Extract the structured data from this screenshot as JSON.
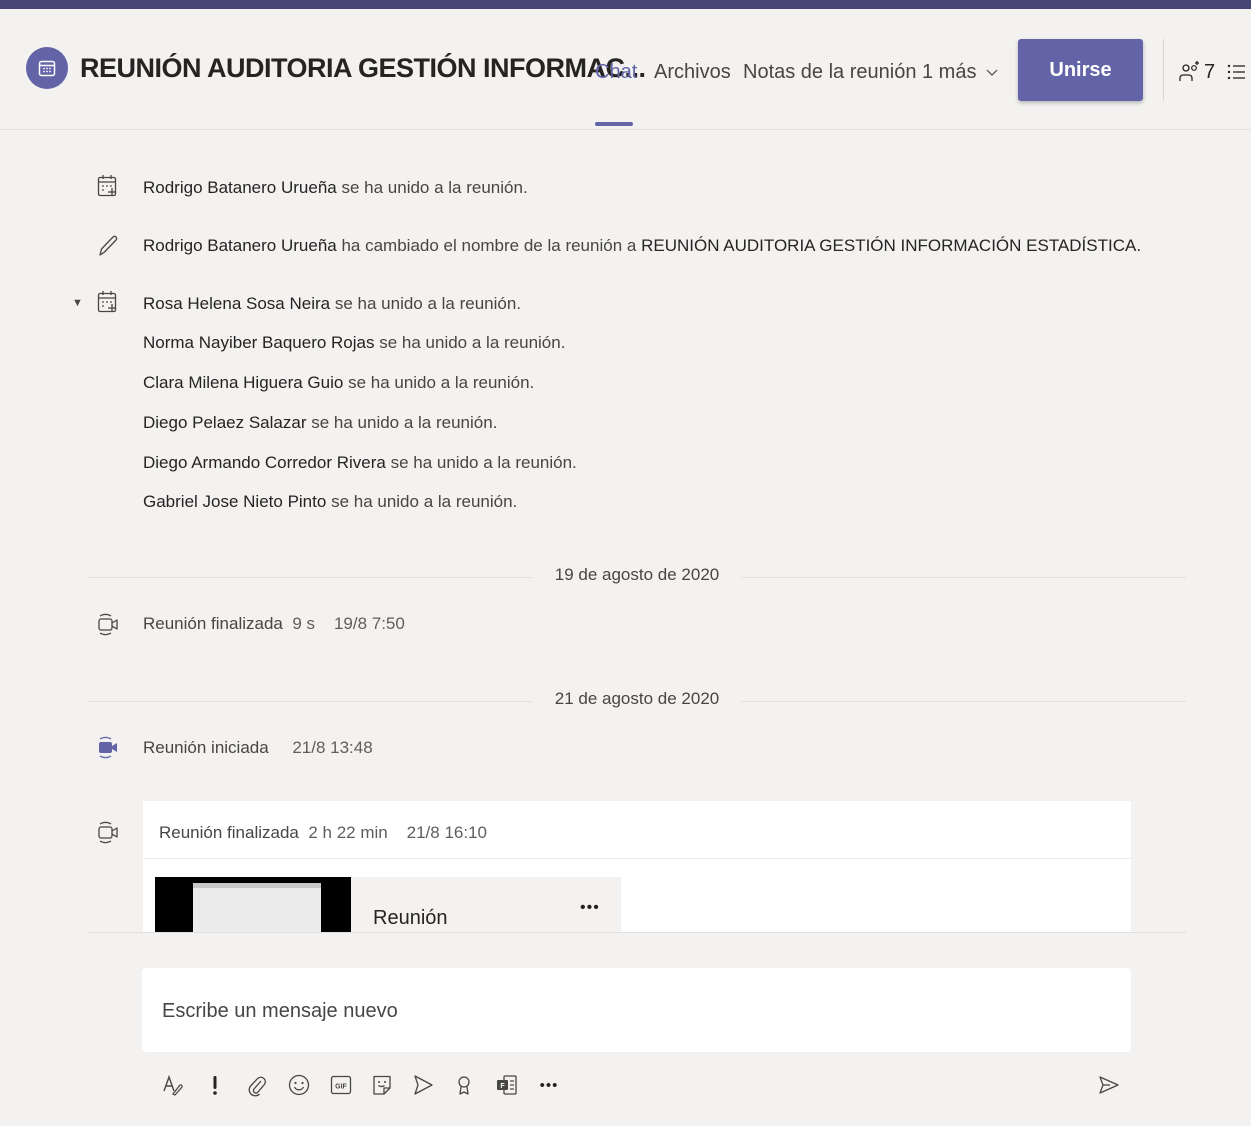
{
  "header": {
    "title": "REUNIÓN AUDITORIA GESTIÓN INFORMAC...",
    "tabs": [
      {
        "label": "Chat",
        "active": true
      },
      {
        "label": "Archivos"
      },
      {
        "label": "Notas de la reunión"
      },
      {
        "label": "1 más"
      }
    ],
    "join_label": "Unirse",
    "participant_count": "7",
    "accent_color": "#6264a7"
  },
  "events": {
    "e1": {
      "name": "Rodrigo Batanero Urueña",
      "text": "se ha unido a la reunión."
    },
    "e2": {
      "name": "Rodrigo Batanero Urueña",
      "text": "ha cambiado el nombre de la reunión a",
      "new_name": "REUNIÓN AUDITORIA GESTIÓN INFORMACIÓN ESTADÍSTICA."
    },
    "joins": [
      {
        "name": "Rosa Helena Sosa Neira",
        "text": "se ha unido a la reunión."
      },
      {
        "name": "Norma Nayiber Baquero Rojas",
        "text": "se ha unido a la reunión."
      },
      {
        "name": "Clara Milena Higuera Guio",
        "text": "se ha unido a la reunión."
      },
      {
        "name": "Diego Pelaez Salazar",
        "text": "se ha unido a la reunión."
      },
      {
        "name": "Diego Armando Corredor Rivera",
        "text": "se ha unido a la reunión."
      },
      {
        "name": "Gabriel Jose Nieto Pinto",
        "text": "se ha unido a la reunión."
      }
    ]
  },
  "dates": {
    "d1": "19 de agosto de 2020",
    "d2": "21 de agosto de 2020"
  },
  "meetings": {
    "ended1": {
      "label": "Reunión finalizada",
      "duration": "9 s",
      "time": "19/8 7:50"
    },
    "started": {
      "label": "Reunión iniciada",
      "time": "21/8 13:48"
    },
    "ended2": {
      "label": "Reunión finalizada",
      "duration": "2 h 22 min",
      "time": "21/8 16:10"
    }
  },
  "recording": {
    "title": "Reunión",
    "more": "•••"
  },
  "compose": {
    "placeholder": "Escribe un mensaje nuevo"
  },
  "toolbar": {
    "icons": [
      "format-icon",
      "important-icon",
      "attach-icon",
      "emoji-icon",
      "gif-icon",
      "sticker-icon",
      "meet-now-icon",
      "praise-icon",
      "forms-icon",
      "more-icon",
      "send-icon"
    ],
    "more_label": "•••"
  }
}
